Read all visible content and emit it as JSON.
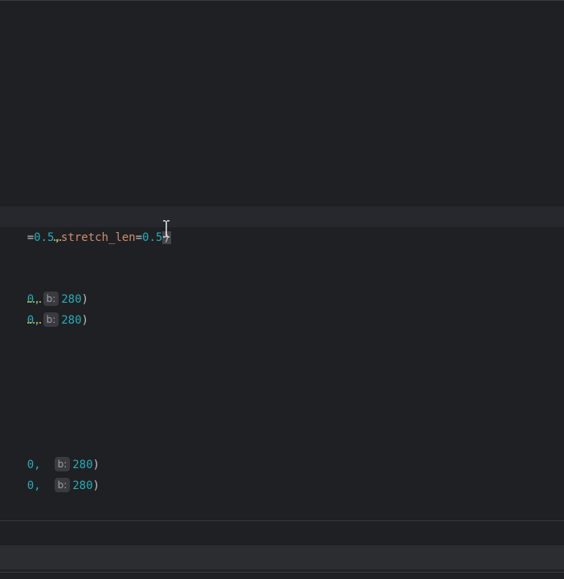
{
  "editor": {
    "line_current": {
      "eq1": "=",
      "val1": "0.5",
      "comma": ",",
      "param": "stretch_len",
      "eq2": "=",
      "val2": "0.5",
      "close": ")"
    },
    "line_a1": {
      "frag": "0,",
      "hint": "b:",
      "val": "280",
      "close": ")"
    },
    "line_a2": {
      "frag": "0,",
      "hint": "b:",
      "val": "280",
      "close": ")"
    },
    "line_b1": {
      "frag": "0,",
      "hint": "b:",
      "val": "280",
      "close": ")"
    },
    "line_b2": {
      "frag": "0,",
      "hint": "b:",
      "val": "280",
      "close": ")"
    }
  }
}
